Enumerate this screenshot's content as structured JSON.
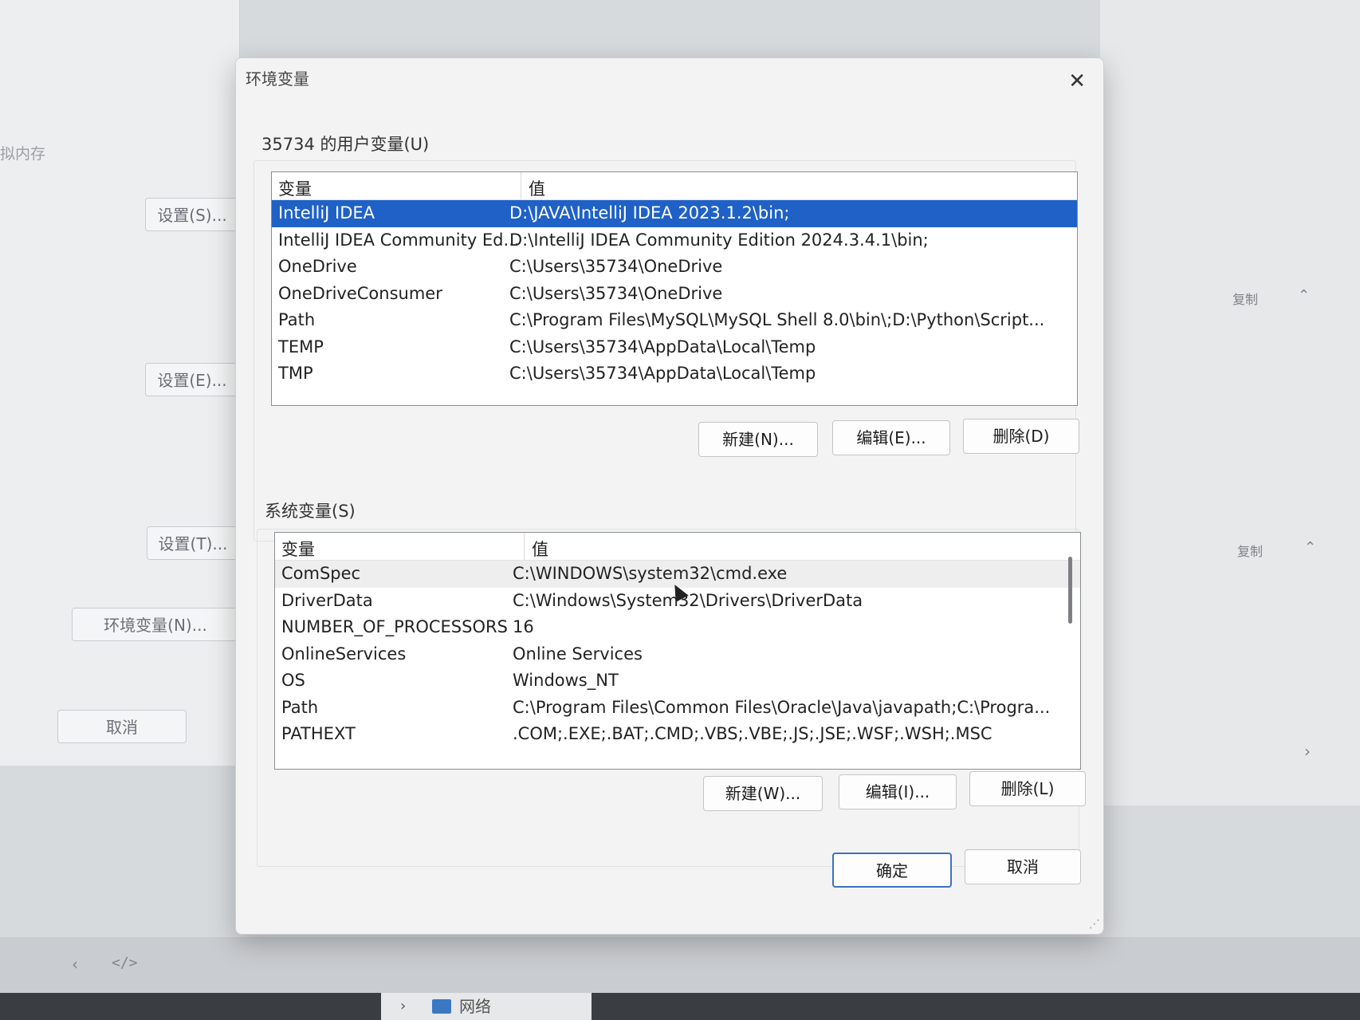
{
  "background": {
    "side_label": "拟内存",
    "buttons": [
      "设置(S)...",
      "设置(E)...",
      "设置(T)...",
      "环境变量(N)...",
      "取消"
    ],
    "right_pane": {
      "copy_label": "复制"
    },
    "taskbar": {
      "network_label": "网络"
    }
  },
  "dialog": {
    "title": "环境变量",
    "user_section": {
      "label": "35734 的用户变量(U)",
      "col_name": "变量",
      "col_value": "值",
      "rows": [
        {
          "name": "IntelliJ IDEA",
          "value": "D:\\JAVA\\IntelliJ IDEA 2023.1.2\\bin;",
          "selected": true
        },
        {
          "name": "IntelliJ IDEA Community Ed...",
          "value": "D:\\IntelliJ IDEA Community Edition 2024.3.4.1\\bin;"
        },
        {
          "name": "OneDrive",
          "value": "C:\\Users\\35734\\OneDrive"
        },
        {
          "name": "OneDriveConsumer",
          "value": "C:\\Users\\35734\\OneDrive"
        },
        {
          "name": "Path",
          "value": "C:\\Program Files\\MySQL\\MySQL Shell 8.0\\bin\\;D:\\Python\\Script..."
        },
        {
          "name": "TEMP",
          "value": "C:\\Users\\35734\\AppData\\Local\\Temp"
        },
        {
          "name": "TMP",
          "value": "C:\\Users\\35734\\AppData\\Local\\Temp"
        }
      ],
      "buttons": {
        "new": "新建(N)...",
        "edit": "编辑(E)...",
        "delete": "删除(D)"
      }
    },
    "system_section": {
      "label": "系统变量(S)",
      "col_name": "变量",
      "col_value": "值",
      "rows": [
        {
          "name": "ComSpec",
          "value": "C:\\WINDOWS\\system32\\cmd.exe",
          "hover": true
        },
        {
          "name": "DriverData",
          "value": "C:\\Windows\\System32\\Drivers\\DriverData"
        },
        {
          "name": "NUMBER_OF_PROCESSORS",
          "value": "16"
        },
        {
          "name": "OnlineServices",
          "value": "Online Services"
        },
        {
          "name": "OS",
          "value": "Windows_NT"
        },
        {
          "name": "Path",
          "value": "C:\\Program Files\\Common Files\\Oracle\\Java\\javapath;C:\\Progra..."
        },
        {
          "name": "PATHEXT",
          "value": ".COM;.EXE;.BAT;.CMD;.VBS;.VBE;.JS;.JSE;.WSF;.WSH;.MSC"
        }
      ],
      "buttons": {
        "new": "新建(W)...",
        "edit": "编辑(I)...",
        "delete": "删除(L)"
      }
    },
    "ok": "确定",
    "cancel": "取消"
  }
}
